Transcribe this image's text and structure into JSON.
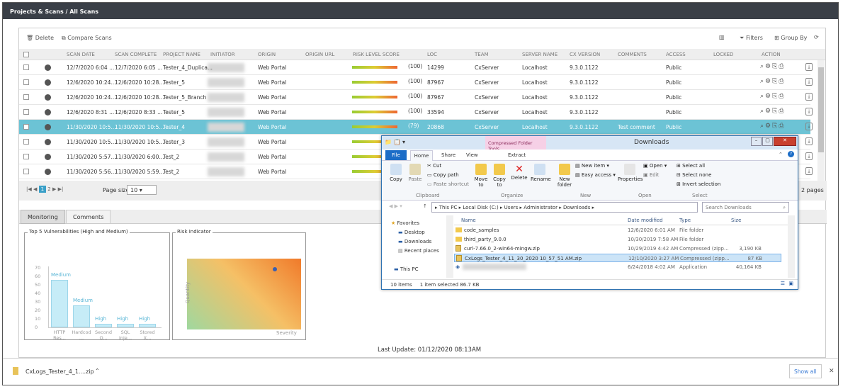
{
  "header": {
    "title": "Projects & Scans / All Scans"
  },
  "toolbar": {
    "delete": "Delete",
    "compare": "Compare Scans",
    "filters": "Filters",
    "group_by": "Group By"
  },
  "columns": [
    "SCAN DATE",
    "SCAN COMPLETE",
    "PROJECT NAME",
    "INITIATOR",
    "ORIGIN",
    "ORIGIN URL",
    "RISK LEVEL SCORE",
    "LOC",
    "TEAM",
    "SERVER NAME",
    "CX VERSION",
    "COMMENTS",
    "ACCESS",
    "LOCKED",
    "ACTION"
  ],
  "rows": [
    {
      "date": "12/7/2020 6:04 ...",
      "complete": "12/7/2020 6:05 ...",
      "project": "Tester_4_Duplica...",
      "origin": "Web Portal",
      "score": "(100)",
      "loc": "14299",
      "team": "CxServer",
      "server": "Localhost",
      "ver": "9.3.0.1122",
      "comments": "",
      "access": "Public"
    },
    {
      "date": "12/6/2020 10:24...",
      "complete": "12/6/2020 10:28...",
      "project": "Tester_5",
      "origin": "Web Portal",
      "score": "(100)",
      "loc": "87967",
      "team": "CxServer",
      "server": "Localhost",
      "ver": "9.3.0.1122",
      "comments": "",
      "access": "Public"
    },
    {
      "date": "12/6/2020 10:24...",
      "complete": "12/6/2020 10:28...",
      "project": "Tester_5_Branch",
      "origin": "Web Portal",
      "score": "(100)",
      "loc": "87967",
      "team": "CxServer",
      "server": "Localhost",
      "ver": "9.3.0.1122",
      "comments": "",
      "access": "Public"
    },
    {
      "date": "12/6/2020 8:31 ...",
      "complete": "12/6/2020 8:33 ...",
      "project": "Tester_5",
      "origin": "Web Portal",
      "score": "(100)",
      "loc": "33594",
      "team": "CxServer",
      "server": "Localhost",
      "ver": "9.3.0.1122",
      "comments": "",
      "access": "Public"
    },
    {
      "date": "11/30/2020 10:5...",
      "complete": "11/30/2020 10:5...",
      "project": "Tester_4",
      "origin": "Web Portal",
      "score": "(79)",
      "loc": "20868",
      "team": "CxServer",
      "server": "Localhost",
      "ver": "9.3.0.1122",
      "comments": "Test comment",
      "access": "Public"
    },
    {
      "date": "11/30/2020 10:5...",
      "complete": "11/30/2020 10:5...",
      "project": "Tester_3",
      "origin": "Web Portal",
      "score": "",
      "loc": "",
      "team": "",
      "server": "",
      "ver": "",
      "comments": "",
      "access": ""
    },
    {
      "date": "11/30/2020 5:57...",
      "complete": "11/30/2020 6:00...",
      "project": "Test_2",
      "origin": "Web Portal",
      "score": "",
      "loc": "",
      "team": "",
      "server": "",
      "ver": "",
      "comments": "",
      "access": ""
    },
    {
      "date": "11/30/2020 5:56...",
      "complete": "11/30/2020 5:59...",
      "project": "Test_2",
      "origin": "Web Portal",
      "score": "",
      "loc": "",
      "team": "",
      "server": "",
      "ver": "",
      "comments": "",
      "access": ""
    }
  ],
  "pager": {
    "p1": "1",
    "p2": "2",
    "size_label": "Page size:",
    "size": "10",
    "pages": "2 pages"
  },
  "tabs": {
    "monitoring": "Monitoring",
    "comments": "Comments"
  },
  "vuln": {
    "title": "Top 5 Vulnerabilities (High and Medium)",
    "yticks": [
      "70",
      "60",
      "50",
      "40",
      "30",
      "20",
      "10",
      "0"
    ],
    "bars": [
      {
        "label": "HTTP Res...",
        "sev": "Medium",
        "value": 56
      },
      {
        "label": "Hardcod ...",
        "sev": "Medium",
        "value": 26
      },
      {
        "label": "Second O...",
        "sev": "High",
        "value": 4
      },
      {
        "label": "SQL Inje...",
        "sev": "High",
        "value": 4
      },
      {
        "label": "Stored X...",
        "sev": "High",
        "value": 4
      }
    ]
  },
  "risk": {
    "title": "Risk Indicator",
    "y": "Quantity",
    "x": "Severity"
  },
  "last_update": "Last Update: 01/12/2020 08:13AM",
  "explorer": {
    "title": "Downloads",
    "ctx_tab": "Compressed Folder Tools",
    "tabs": [
      "File",
      "Home",
      "Share",
      "View",
      "Extract"
    ],
    "ribbon": {
      "copy": "Copy",
      "paste": "Paste",
      "cut": "Cut",
      "copy_path": "Copy path",
      "paste_shortcut": "Paste shortcut",
      "clipboard": "Clipboard",
      "move": "Move to",
      "copy_to": "Copy to",
      "delete": "Delete",
      "rename": "Rename",
      "organize": "Organize",
      "new_folder": "New folder",
      "new_item": "New item",
      "easy_access": "Easy access",
      "new": "New",
      "properties": "Properties",
      "open": "Open",
      "edit": "Edit",
      "open_grp": "Open",
      "select_all": "Select all",
      "select_none": "Select none",
      "invert": "Invert selection",
      "select": "Select"
    },
    "path": [
      "This PC",
      "Local Disk (C:)",
      "Users",
      "Administrator",
      "Downloads"
    ],
    "search": "Search Downloads",
    "nav": [
      "Favorites",
      "Desktop",
      "Downloads",
      "Recent places",
      "This PC"
    ],
    "cols": [
      "Name",
      "Date modified",
      "Type",
      "Size"
    ],
    "files": [
      {
        "name": "code_samples",
        "date": "12/6/2020 6:01 AM",
        "type": "File folder",
        "size": ""
      },
      {
        "name": "third_party_9.0.0",
        "date": "10/30/2019 7:58 AM",
        "type": "File folder",
        "size": ""
      },
      {
        "name": "curl-7.66.0_2-win64-mingw.zip",
        "date": "10/29/2019 4:42 AM",
        "type": "Compressed (zipp...",
        "size": "3,190 KB"
      },
      {
        "name": "CxLogs_Tester_4_11_30_2020 10_57_51 AM.zip",
        "date": "12/10/2020 3:27 AM",
        "type": "Compressed (zipp...",
        "size": "87 KB"
      },
      {
        "name": "",
        "date": "6/24/2018 4:02 AM",
        "type": "Application",
        "size": "40,164 KB"
      }
    ],
    "status": {
      "items": "10 items",
      "selected": "1 item selected",
      "size": "86.7 KB"
    }
  },
  "download": {
    "file": "CxLogs_Tester_4_1....zip",
    "show_all": "Show all"
  }
}
